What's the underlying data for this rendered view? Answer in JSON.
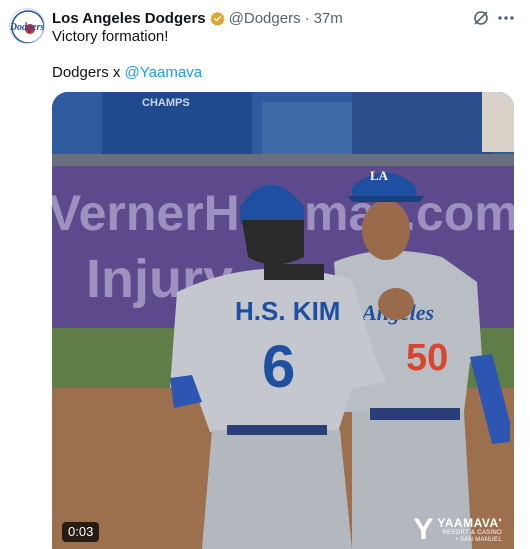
{
  "account": {
    "name": "Los Angeles Dodgers",
    "handle": "@Dodgers",
    "separator": "·",
    "time": "37m",
    "avatar_text": "Dodgers"
  },
  "tweet": {
    "line1": "Victory formation!",
    "line2_prefix": "Dodgers x ",
    "mention": "@Yaamava"
  },
  "media": {
    "timer": "0:03",
    "banner_line1": "VernerHe",
    "banner_line1b": "ma",
    "banner_line1c": ".com",
    "banner_line2": "Injury",
    "champs_text": "CHAMPS",
    "player_left_name": "H.S. KIM",
    "player_left_number": "6",
    "player_right_team": "Angeles",
    "player_right_number": "50",
    "cap_logo": "LA",
    "brand_mark": "Y",
    "brand_name": "YAAMAVA'",
    "brand_sub1": "RESORT & CASINO",
    "brand_sub2": "• SAN MANUEL"
  },
  "colors": {
    "verified": "#e0a32e",
    "link": "#1d9bf0",
    "dodger_blue": "#1e4fa0",
    "jersey_gray": "#b9bec5"
  },
  "icons": {
    "grok": "grok-icon",
    "more": "more-icon",
    "verified": "verified-badge-icon"
  }
}
